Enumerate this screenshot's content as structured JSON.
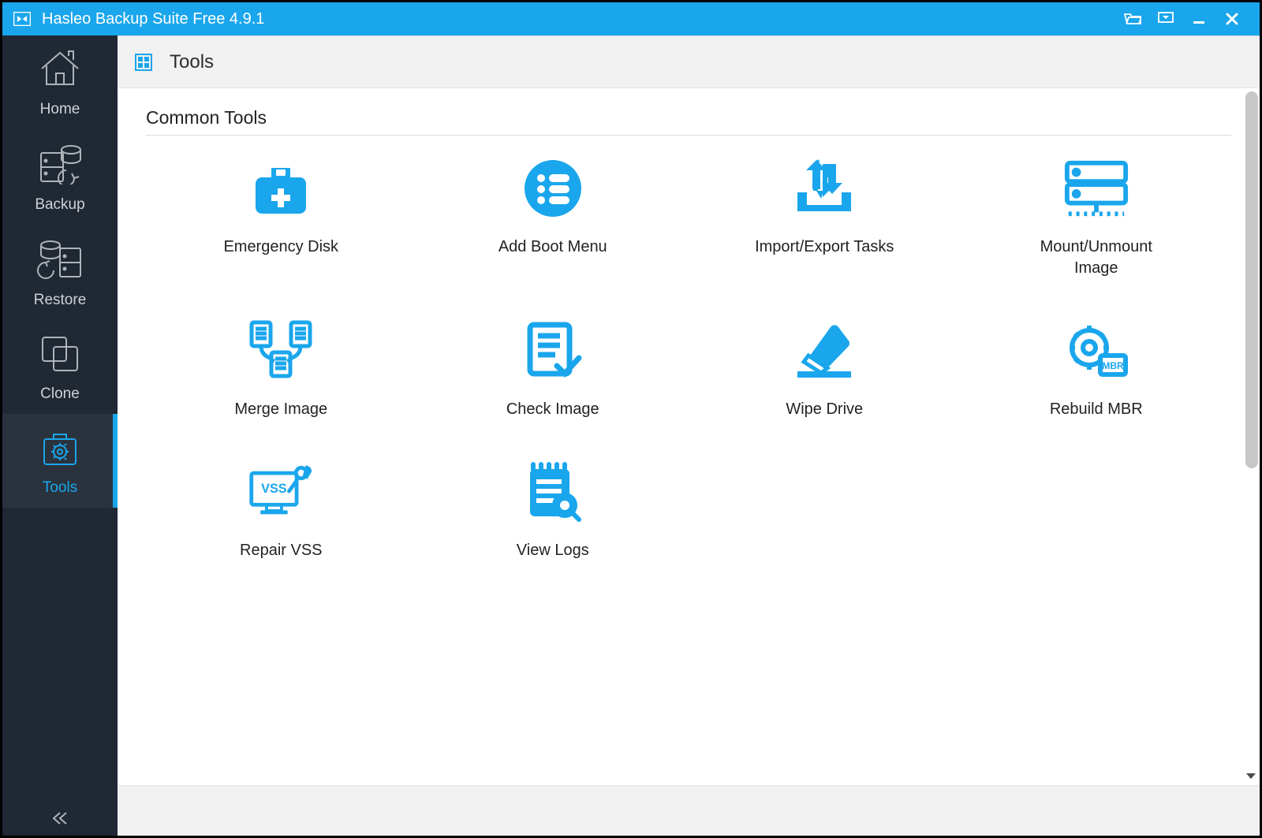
{
  "titlebar": {
    "title": "Hasleo Backup Suite Free 4.9.1"
  },
  "sidebar": {
    "items": [
      {
        "label": "Home",
        "icon": "home-icon",
        "active": false
      },
      {
        "label": "Backup",
        "icon": "backup-icon",
        "active": false
      },
      {
        "label": "Restore",
        "icon": "restore-icon",
        "active": false
      },
      {
        "label": "Clone",
        "icon": "clone-icon",
        "active": false
      },
      {
        "label": "Tools",
        "icon": "tools-icon",
        "active": true
      }
    ]
  },
  "page": {
    "title": "Tools",
    "section": "Common Tools",
    "tools": [
      {
        "label": "Emergency Disk",
        "icon": "emergency-disk-icon"
      },
      {
        "label": "Add Boot Menu",
        "icon": "boot-menu-icon"
      },
      {
        "label": "Import/Export Tasks",
        "icon": "import-export-icon"
      },
      {
        "label": "Mount/Unmount Image",
        "icon": "mount-image-icon"
      },
      {
        "label": "Merge Image",
        "icon": "merge-image-icon"
      },
      {
        "label": "Check Image",
        "icon": "check-image-icon"
      },
      {
        "label": "Wipe Drive",
        "icon": "wipe-drive-icon"
      },
      {
        "label": "Rebuild MBR",
        "icon": "rebuild-mbr-icon"
      },
      {
        "label": "Repair VSS",
        "icon": "repair-vss-icon"
      },
      {
        "label": "View Logs",
        "icon": "view-logs-icon"
      }
    ]
  },
  "colors": {
    "accent": "#1aa6ec",
    "sidebar": "#1f2833"
  }
}
